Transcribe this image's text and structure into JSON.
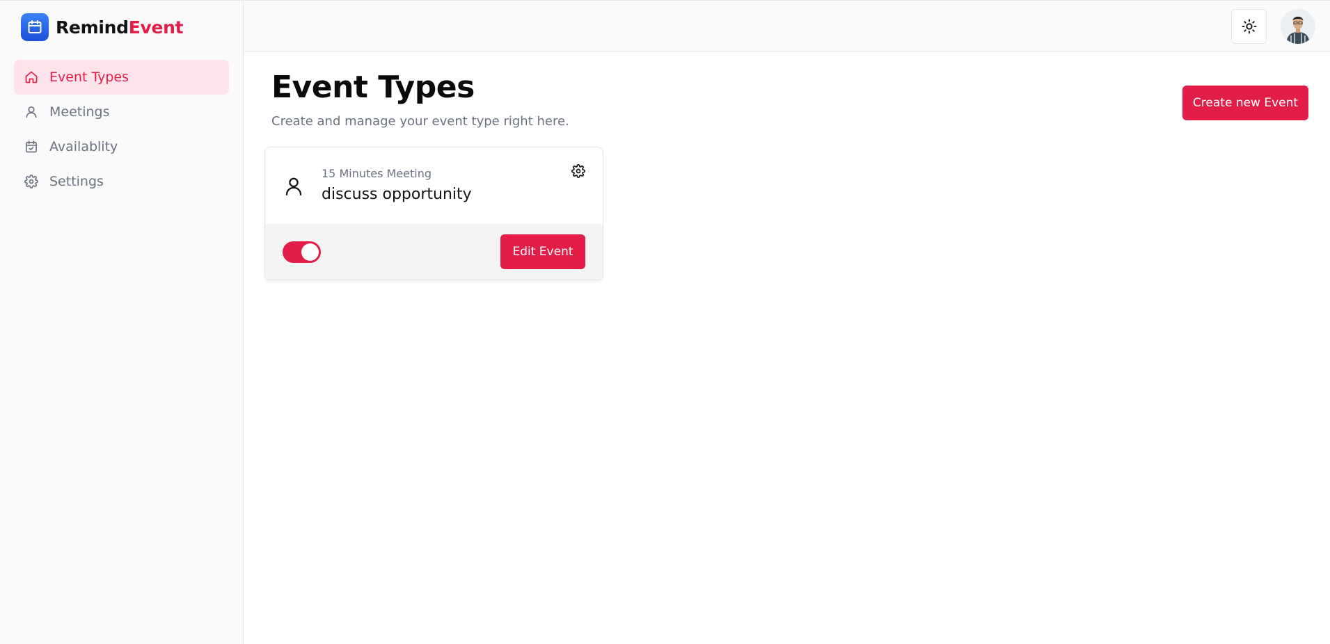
{
  "app": {
    "name_part1": "Remind",
    "name_part2": "Event",
    "accent_color": "#e11d48",
    "logo_icon": "calendar-icon"
  },
  "sidebar": {
    "items": [
      {
        "label": "Event Types",
        "icon": "home-icon",
        "active": true
      },
      {
        "label": "Meetings",
        "icon": "user-icon",
        "active": false
      },
      {
        "label": "Availablity",
        "icon": "calendar-check-icon",
        "active": false
      },
      {
        "label": "Settings",
        "icon": "gear-icon",
        "active": false
      }
    ]
  },
  "header": {
    "theme_toggle_icon": "sun-icon",
    "avatar_icon": "user-avatar"
  },
  "main": {
    "title": "Event Types",
    "subtitle": "Create and manage your event type right here.",
    "create_button_label": "Create new Event",
    "events": [
      {
        "duration_label": "15 Minutes Meeting",
        "title": "discuss opportunity",
        "enabled": true,
        "edit_button_label": "Edit Event"
      }
    ]
  }
}
